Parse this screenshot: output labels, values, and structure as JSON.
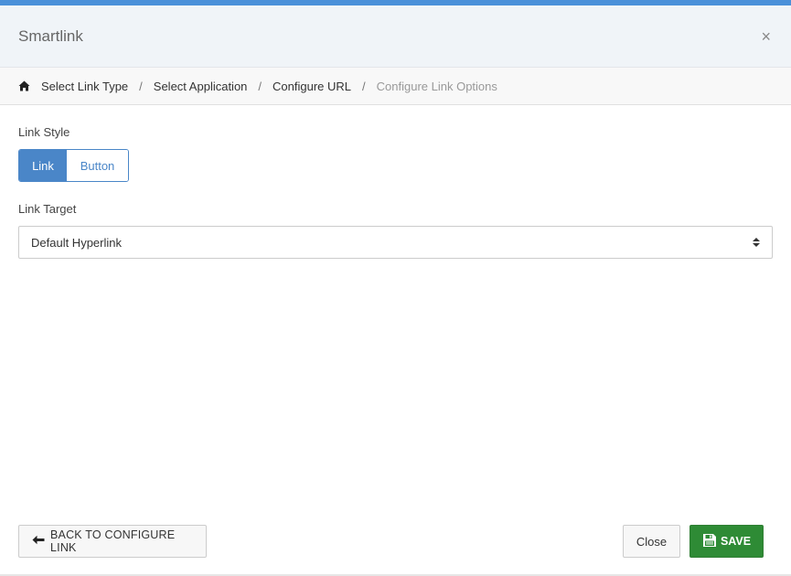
{
  "modal": {
    "title": "Smartlink",
    "close_symbol": "×",
    "accent_color": "#4a90d9"
  },
  "breadcrumb": {
    "home_icon": "home-icon",
    "items": [
      {
        "label": "Select Link Type"
      },
      {
        "label": "Select Application"
      },
      {
        "label": "Configure URL"
      },
      {
        "label": "Configure Link Options"
      }
    ],
    "separator": "/"
  },
  "form": {
    "link_style": {
      "label": "Link Style",
      "options": [
        "Link",
        "Button"
      ],
      "selected": "Link",
      "active_color": "#4a86c8"
    },
    "link_target": {
      "label": "Link Target",
      "value": "Default Hyperlink"
    }
  },
  "footer": {
    "back_label": "BACK TO CONFIGURE LINK",
    "close_label": "Close",
    "save_label": "SAVE",
    "save_color": "#2e8b35"
  }
}
